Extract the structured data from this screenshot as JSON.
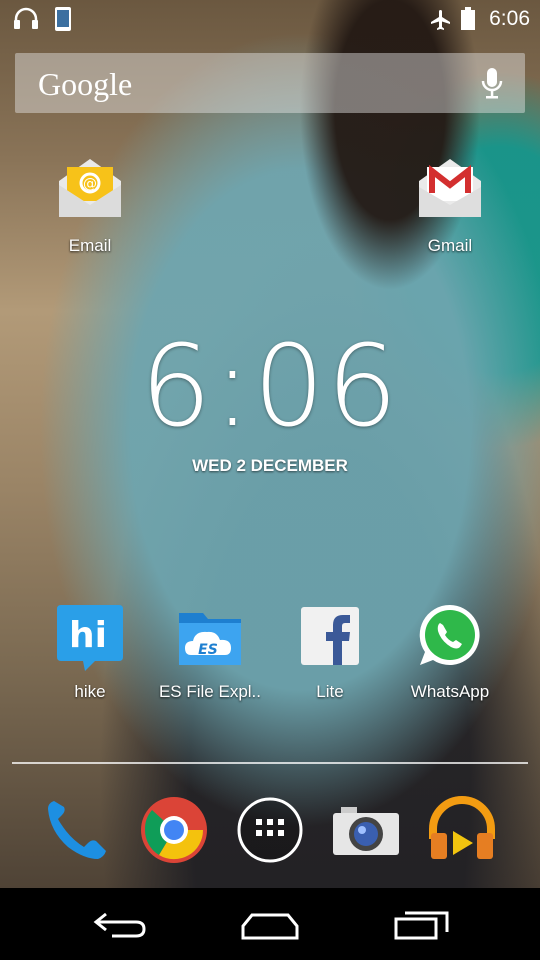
{
  "status_bar": {
    "time": "6:06",
    "icons": [
      "headphones-icon",
      "phone-icon",
      "airplane-icon",
      "battery-icon"
    ]
  },
  "search": {
    "label": "Google",
    "icon": "mic-icon"
  },
  "clock": {
    "time": "6:06",
    "date": "WED 2 DECEMBER"
  },
  "apps": {
    "email": "Email",
    "gmail": "Gmail",
    "hike": "hike",
    "es": "ES File Expl..",
    "facebook": "Lite",
    "whatsapp": "WhatsApp"
  },
  "dock": [
    "phone-icon",
    "chrome-icon",
    "app-drawer-icon",
    "camera-icon",
    "play-music-icon"
  ],
  "nav": [
    "back-icon",
    "home-icon",
    "recents-icon"
  ]
}
